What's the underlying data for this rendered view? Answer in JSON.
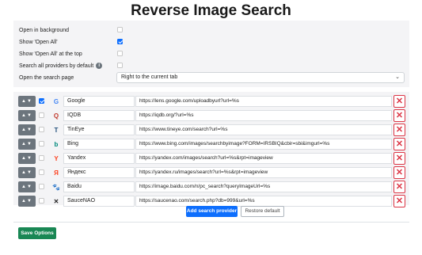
{
  "page_title": "Reverse Image Search",
  "options": {
    "open_in_background": {
      "label": "Open in background",
      "checked": false
    },
    "show_open_all": {
      "label": "Show 'Open All'",
      "checked": true
    },
    "show_open_all_top": {
      "label": "Show 'Open All' at the top",
      "checked": false
    },
    "search_all_default": {
      "label": "Search all providers by default",
      "checked": false,
      "info": "i"
    },
    "open_search_page": {
      "label": "Open the search page",
      "selected": "Right to the current tab",
      "chevron": "⌄"
    }
  },
  "providers": [
    {
      "enabled": true,
      "icon": "google-icon",
      "glyph": "G",
      "name": "Google",
      "url": "https://lens.google.com/uploadbyurl?url=%s",
      "color": "#4285f4"
    },
    {
      "enabled": false,
      "icon": "iqdb-icon",
      "glyph": "Q",
      "name": "IQDB",
      "url": "https://iqdb.org/?url=%s",
      "color": "#c0392b"
    },
    {
      "enabled": false,
      "icon": "tineye-icon",
      "glyph": "T",
      "name": "TinEye",
      "url": "https://www.tineye.com/search?url=%s",
      "color": "#1f4e79"
    },
    {
      "enabled": false,
      "icon": "bing-icon",
      "glyph": "b",
      "name": "Bing",
      "url": "https://www.bing.com/images/searchbyimage?FORM=IRSBIQ&cbir=sbi&imgurl=%s",
      "color": "#00897b"
    },
    {
      "enabled": false,
      "icon": "yandex-icon",
      "glyph": "Y",
      "name": "Yandex",
      "url": "https://yandex.com/images/search?url=%s&rpt=imageview",
      "color": "#fc3f1d"
    },
    {
      "enabled": false,
      "icon": "yandex-ru-icon",
      "glyph": "Я",
      "name": "Яндекс",
      "url": "https://yandex.ru/images/search?url=%s&rpt=imageview",
      "color": "#fc3f1d"
    },
    {
      "enabled": false,
      "icon": "baidu-icon",
      "glyph": "🐾",
      "name": "Baidu",
      "url": "https://image.baidu.com/n/pc_search?queryImageUrl=%s",
      "color": "#2932e1"
    },
    {
      "enabled": false,
      "icon": "saucenao-icon",
      "glyph": "✕",
      "name": "SauceNAO",
      "url": "https://saucenao.com/search.php?db=999&url=%s",
      "color": "#222222"
    }
  ],
  "row_controls": {
    "move_arrows": "▲▼",
    "delete_glyph": "✕"
  },
  "buttons": {
    "add_provider": "Add search provider",
    "restore_default": "Restore default",
    "save_options": "Save Options"
  },
  "colors": {
    "primary": "#0d6efd",
    "success": "#198754",
    "danger": "#dc3545",
    "panel": "#f4f4f6"
  }
}
